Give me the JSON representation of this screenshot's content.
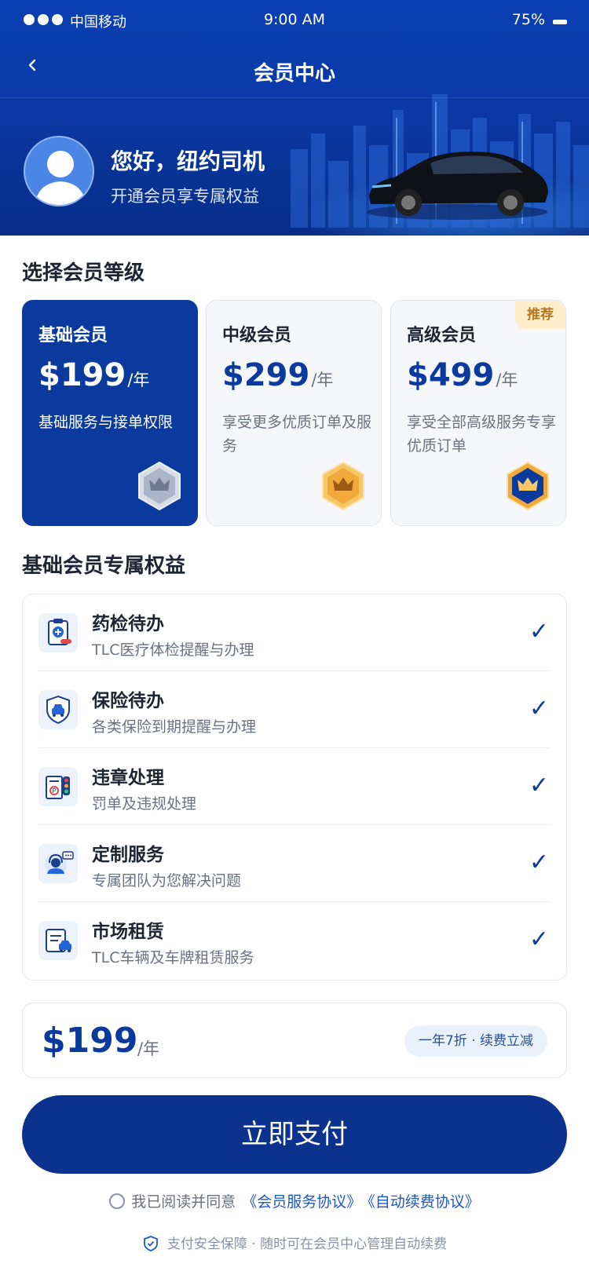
{
  "status_bar": {
    "carrier": "中国移动",
    "time": "9:00 AM",
    "battery": "75%"
  },
  "nav": {
    "title": "会员中心"
  },
  "profile": {
    "greeting": "您好，纽约司机",
    "subtitle": "开通会员享专属权益"
  },
  "tiers_section": {
    "title": "选择会员等级"
  },
  "tiers": [
    {
      "name": "基础会员",
      "price": "$199",
      "unit": "/年",
      "desc": "基础服务与接单权限",
      "selected": true,
      "badge_color": "#aab6c8"
    },
    {
      "name": "中级会员",
      "price": "$299",
      "unit": "/年",
      "desc": "享受更多优质订单及服务",
      "selected": false,
      "badge_color": "#f0a93a"
    },
    {
      "name": "高级会员",
      "price": "$499",
      "unit": "/年",
      "desc": "享受全部高级服务专享优质订单",
      "selected": false,
      "badge_color": "#0b3a9e",
      "tag": "推荐"
    }
  ],
  "benefits_section": {
    "title": "基础会员专属权益"
  },
  "benefits": [
    {
      "icon": "clipboard-medical-icon",
      "title": "药检待办",
      "desc": "TLC医疗体检提醒与办理",
      "check": "✓"
    },
    {
      "icon": "shield-car-icon",
      "title": "保险待办",
      "desc": "各类保险到期提醒与办理",
      "check": "✓"
    },
    {
      "icon": "traffic-light-icon",
      "title": "违章处理",
      "desc": "罚单及违规处理",
      "check": "✓"
    },
    {
      "icon": "customer-service-icon",
      "title": "定制服务",
      "desc": "专属团队为您解决问题",
      "check": "✓"
    },
    {
      "icon": "document-car-icon",
      "title": "市场租赁",
      "desc": "TLC车辆及车牌租赁服务",
      "check": "✓"
    }
  ],
  "summary": {
    "price": "$199",
    "unit": "/年",
    "promo": "一年7折 · 续费立减"
  },
  "pay_button": {
    "label": "立即支付"
  },
  "agreement": {
    "text": "我已阅读并同意",
    "link1": "《会员服务协议》",
    "link2": "《自动续费协议》"
  },
  "footer": {
    "note": "支付安全保障 · 随时可在会员中心管理自动续费"
  },
  "colors": {
    "brand": "#0b3a9e",
    "header": "#0b3fb3",
    "accent_gold": "#f0a93a"
  }
}
